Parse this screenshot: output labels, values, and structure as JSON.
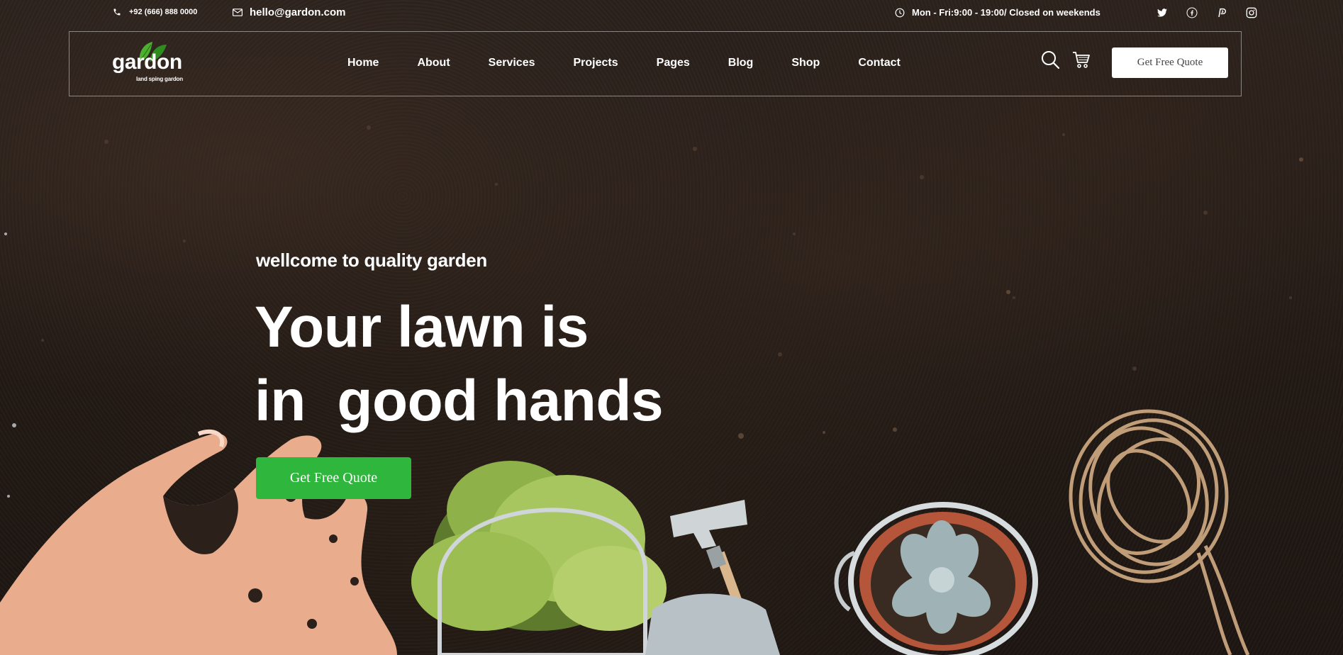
{
  "topbar": {
    "phone": "+92 (666) 888 0000",
    "email": "hello@gardon.com",
    "hours": "Mon - Fri:9:00 - 19:00/ Closed on weekends",
    "socials": [
      "twitter-icon",
      "facebook-icon",
      "pinterest-icon",
      "instagram-icon"
    ]
  },
  "brand": {
    "name": "gardon",
    "tagline": "land sping gardon"
  },
  "nav": {
    "items": [
      "Home",
      "About",
      "Services",
      "Projects",
      "Pages",
      "Blog",
      "Shop",
      "Contact"
    ],
    "quote_button": "Get Free Quote"
  },
  "hero": {
    "subtitle": "wellcome to quality garden",
    "title_line1": "Your lawn is",
    "title_line2": "in  good hands",
    "cta": "Get Free Quote"
  },
  "colors": {
    "accent": "#2fb63c",
    "background": "#241b15",
    "text": "#ffffff"
  }
}
